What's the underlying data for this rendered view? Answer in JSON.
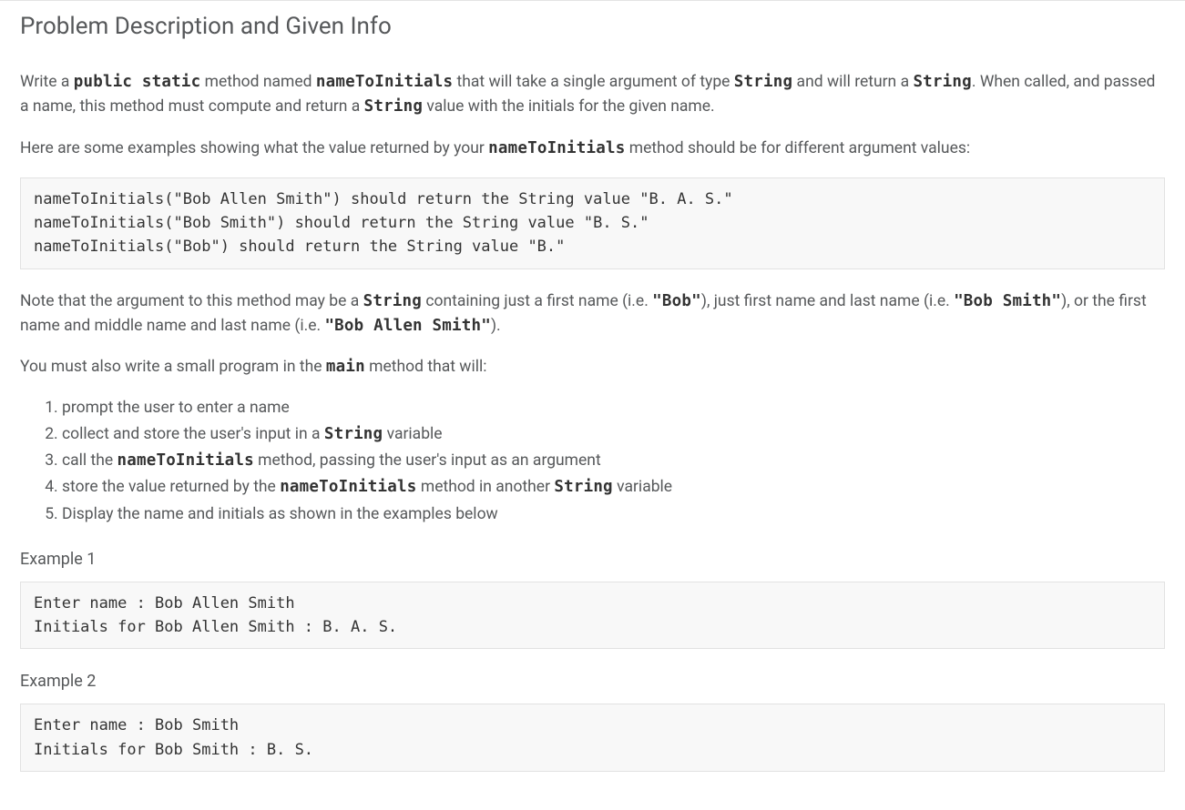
{
  "title": "Problem Description and Given Info",
  "para1": {
    "t1": "Write a ",
    "c1": "public static",
    "t2": " method named ",
    "c2": "nameToInitials",
    "t3": " that will take a single argument of type ",
    "c3": "String",
    "t4": " and will return a ",
    "c4": "String",
    "t5": ". When called, and passed a name, this method must compute and return a ",
    "c5": "String",
    "t6": " value with the initials for the given name."
  },
  "para2": {
    "t1": "Here are some examples showing what the value returned by your ",
    "c1": "nameToInitials",
    "t2": " method should be for different argument values:"
  },
  "codeBlock1": "nameToInitials(\"Bob Allen Smith\") should return the String value \"B. A. S.\"\nnameToInitials(\"Bob Smith\") should return the String value \"B. S.\"\nnameToInitials(\"Bob\") should return the String value \"B.\"",
  "para3": {
    "t1": "Note that the argument to this method may be a ",
    "c1": "String",
    "t2": " containing just a first name (i.e. ",
    "c2": "\"Bob\"",
    "t3": "), just first name and last name (i.e. ",
    "c3": "\"Bob Smith\"",
    "t4": "), or the first name and middle name and last name (i.e. ",
    "c4": "\"Bob Allen Smith\"",
    "t5": ")."
  },
  "para4": {
    "t1": "You must also write a small program in the ",
    "c1": "main",
    "t2": " method that will:"
  },
  "steps": {
    "s1": "prompt the user to enter a name",
    "s2a": "collect and store the user's input in a ",
    "s2c": "String",
    "s2b": " variable",
    "s3a": "call the ",
    "s3c": "nameToInitials",
    "s3b": " method, passing the user's input as an argument",
    "s4a": "store the value returned by the ",
    "s4c1": "nameToInitials",
    "s4m": " method in another ",
    "s4c2": "String",
    "s4b": " variable",
    "s5": "Display the name and initials as shown in the examples below"
  },
  "example1Label": "Example 1",
  "example1Block": "Enter name : Bob Allen Smith\nInitials for Bob Allen Smith : B. A. S.",
  "example2Label": "Example 2",
  "example2Block": "Enter name : Bob Smith\nInitials for Bob Smith : B. S."
}
